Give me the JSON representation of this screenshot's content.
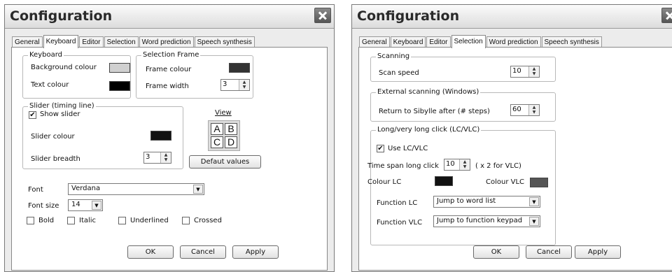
{
  "dialog1": {
    "title": "Configuration",
    "tabs": [
      {
        "label": "General"
      },
      {
        "label": "Keyboard"
      },
      {
        "label": "Editor"
      },
      {
        "label": "Selection"
      },
      {
        "label": "Word prediction"
      },
      {
        "label": "Speech synthesis"
      }
    ],
    "active_tab": "Keyboard",
    "keyboard_group": {
      "legend": "Keyboard",
      "bg_label": "Background colour",
      "bg_color": "#d0d0d0",
      "text_label": "Text colour",
      "text_color": "#000000"
    },
    "frame_group": {
      "legend": "Selection Frame",
      "color_label": "Frame colour",
      "color": "#333333",
      "width_label": "Frame width",
      "width_value": "3"
    },
    "slider_group": {
      "legend": "Slider (timing line)",
      "show_label": "Show slider",
      "show_checked": "✔",
      "color_label": "Slider colour",
      "color": "#111111",
      "breadth_label": "Slider breadth",
      "breadth_value": "3"
    },
    "view": {
      "label": "View",
      "letters": [
        "A",
        "B",
        "C",
        "D"
      ]
    },
    "default_button": "Defaut values",
    "font_label": "Font",
    "font_value": "Verdana",
    "size_label": "Font size",
    "size_value": "14",
    "styles": [
      {
        "label": "Bold"
      },
      {
        "label": "Italic"
      },
      {
        "label": "Underlined"
      },
      {
        "label": "Crossed"
      }
    ],
    "ok": "OK",
    "cancel": "Cancel",
    "apply": "Apply"
  },
  "dialog2": {
    "title": "Configuration",
    "tabs": [
      {
        "label": "General"
      },
      {
        "label": "Keyboard"
      },
      {
        "label": "Editor"
      },
      {
        "label": "Selection"
      },
      {
        "label": "Word prediction"
      },
      {
        "label": "Speech synthesis"
      }
    ],
    "active_tab": "Selection",
    "scanning": {
      "legend": "Scanning",
      "speed_label": "Scan speed",
      "speed_value": "10"
    },
    "external": {
      "legend": "External scanning (Windows)",
      "return_label": "Return to Sibylle after (# steps)",
      "return_value": "60"
    },
    "lc": {
      "legend": "Long/very long click (LC/VLC)",
      "use_label": "Use LC/VLC",
      "use_checked": "✔",
      "span_label": "Time span long click",
      "span_value": "10",
      "span_suffix": "( x 2 for VLC)",
      "colour_lc_label": "Colour LC",
      "colour_lc": "#111111",
      "colour_vlc_label": "Colour VLC",
      "colour_vlc": "#555555",
      "func_lc_label": "Function LC",
      "func_lc_value": "Jump to word list",
      "func_vlc_label": "Function VLC",
      "func_vlc_value": "Jump to function keypad"
    },
    "ok": "OK",
    "cancel": "Cancel",
    "apply": "Apply"
  }
}
